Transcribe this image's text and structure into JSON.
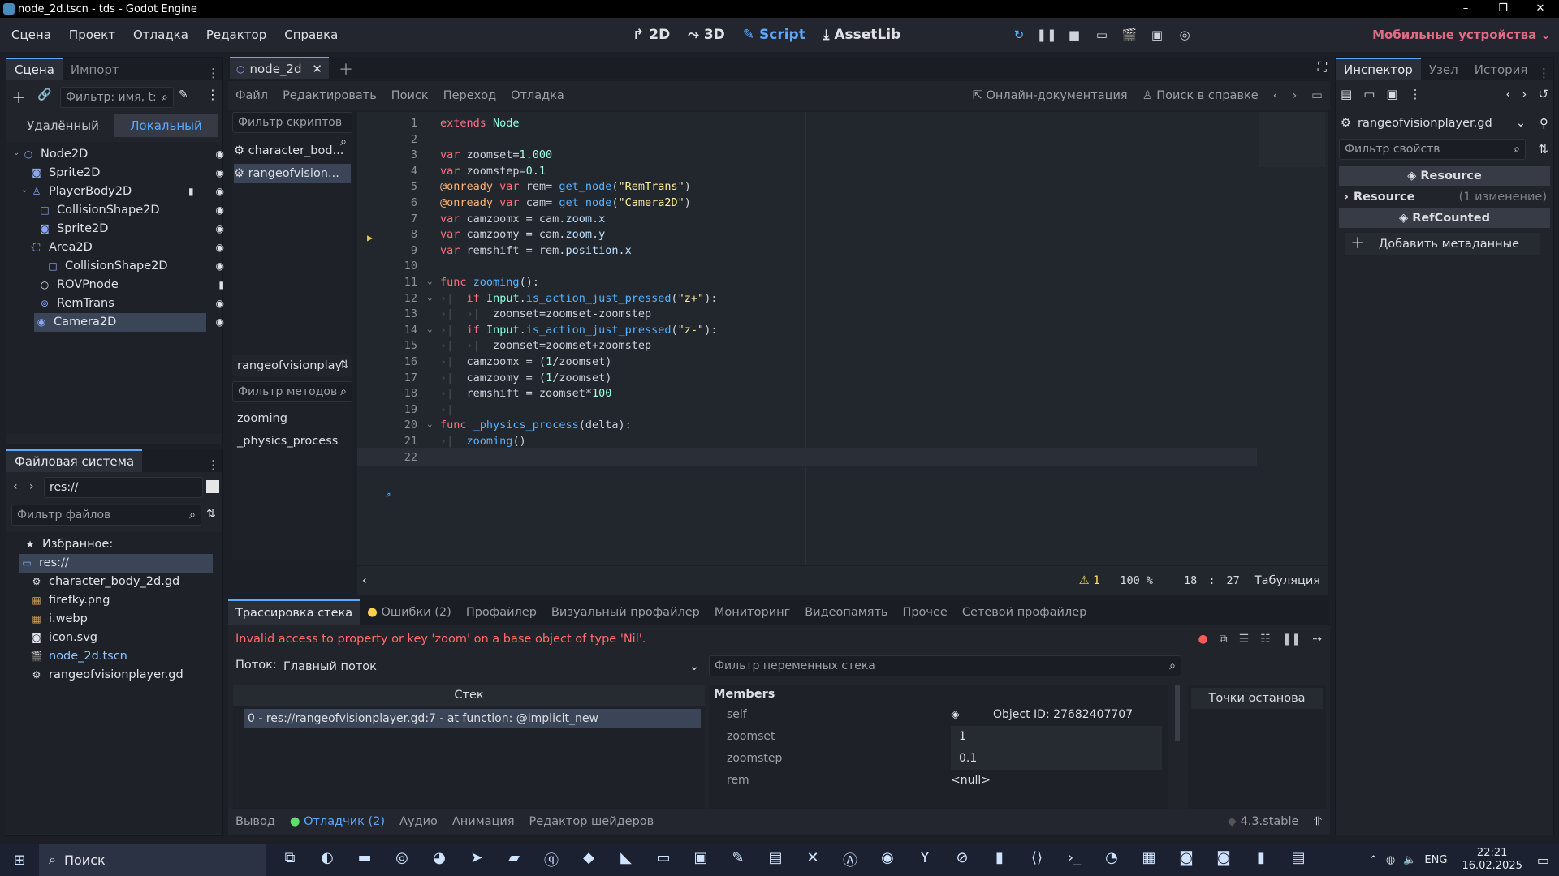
{
  "window": {
    "title": "node_2d.tscn - tds - Godot Engine",
    "minimize": "–",
    "maximize": "❐",
    "close": "✕"
  },
  "menu": [
    "Сцена",
    "Проект",
    "Отладка",
    "Редактор",
    "Справка"
  ],
  "modes": [
    {
      "label": "2D",
      "icon": "2d-icon",
      "glyph": "↱"
    },
    {
      "label": "3D",
      "icon": "3d-icon",
      "glyph": "⤳"
    },
    {
      "label": "Script",
      "icon": "script-icon",
      "glyph": "✎"
    },
    {
      "label": "AssetLib",
      "icon": "assetlib-icon",
      "glyph": "⤓"
    }
  ],
  "run_controls": [
    {
      "icon": "restart-icon",
      "glyph": "↻"
    },
    {
      "icon": "pause-icon",
      "glyph": "❚❚"
    },
    {
      "icon": "stop-icon",
      "glyph": "■"
    },
    {
      "icon": "remote-debug-icon",
      "glyph": "▭"
    },
    {
      "icon": "play-scene-icon",
      "glyph": "🎬"
    },
    {
      "icon": "play-custom-icon",
      "glyph": "▣"
    },
    {
      "icon": "movie-maker-icon",
      "glyph": "◎"
    }
  ],
  "renderer": "Мобильные устройства ⌄",
  "scene_panel": {
    "tabs": [
      "Сцена",
      "Импорт"
    ],
    "filter_placeholder": "Фильтр: имя, t:",
    "mode_tabs": [
      "Удалённый",
      "Локальный"
    ],
    "nodes": [
      {
        "name": "Node2D",
        "icon": "node2d-icon",
        "glyph": "○",
        "color": "#8da5f3"
      },
      {
        "name": "Sprite2D",
        "icon": "sprite2d-icon",
        "glyph": "◙",
        "color": "#8da5f3"
      },
      {
        "name": "PlayerBody2D",
        "icon": "characterbody2d-icon",
        "glyph": "♙",
        "color": "#8da5f3"
      },
      {
        "name": "CollisionShape2D",
        "icon": "collisionshape2d-icon",
        "glyph": "□",
        "color": "#8da5f3"
      },
      {
        "name": "Sprite2D",
        "icon": "sprite2d-icon",
        "glyph": "◙",
        "color": "#8da5f3"
      },
      {
        "name": "Area2D",
        "icon": "area2d-icon",
        "glyph": "⛶",
        "color": "#8da5f3"
      },
      {
        "name": "CollisionShape2D",
        "icon": "collisionshape2d-icon",
        "glyph": "□",
        "color": "#8da5f3"
      },
      {
        "name": "ROVPnode",
        "icon": "node-icon",
        "glyph": "○",
        "color": "#e0e0e0"
      },
      {
        "name": "RemTrans",
        "icon": "remotetransform2d-icon",
        "glyph": "⊚",
        "color": "#8da5f3"
      },
      {
        "name": "Camera2D",
        "icon": "camera2d-icon",
        "glyph": "◉",
        "color": "#8da5f3"
      }
    ]
  },
  "filesystem": {
    "title": "Файловая система",
    "path": "res://",
    "filter_placeholder": "Фильтр файлов",
    "favorites": "Избранное:",
    "items": [
      {
        "name": "res://",
        "icon": "folder-icon",
        "glyph": "▭"
      },
      {
        "name": "character_body_2d.gd",
        "icon": "gdscript-icon",
        "glyph": "⚙"
      },
      {
        "name": "firefky.png",
        "icon": "image-icon",
        "glyph": "▦"
      },
      {
        "name": "i.webp",
        "icon": "image-icon",
        "glyph": "▦"
      },
      {
        "name": "icon.svg",
        "icon": "svg-icon",
        "glyph": "◙"
      },
      {
        "name": "node_2d.tscn",
        "icon": "scene-icon",
        "glyph": "🎬"
      },
      {
        "name": "rangeofvisionplayer.gd",
        "icon": "gdscript-icon",
        "glyph": "⚙"
      }
    ]
  },
  "editor_tab": "node_2d",
  "script_menu": [
    "Файл",
    "Редактировать",
    "Поиск",
    "Переход",
    "Отладка"
  ],
  "online_docs": "Онлайн-документация",
  "search_help": "Поиск в справке",
  "scripts_filter": "Фильтр скриптов",
  "scripts": [
    "character_bod...",
    "rangeofvision..."
  ],
  "current_script_name": "rangeofvisionplay",
  "methods_filter": "Фильтр методов",
  "methods": [
    "zooming",
    "_physics_process"
  ],
  "code_lines": [
    {
      "n": "1",
      "html": "<span class='kw'>extends</span> <span class='cls'>Node</span>"
    },
    {
      "n": "2",
      "html": ""
    },
    {
      "n": "3",
      "html": "<span class='kw'>var</span> zoomset=<span class='num'>1.000</span>"
    },
    {
      "n": "4",
      "html": "<span class='kw'>var</span> zoomstep=<span class='num'>0.1</span>"
    },
    {
      "n": "5",
      "html": "<span class='ann'>@onready</span> <span class='kw'>var</span> rem= <span class='fn'>get_node</span>(<span class='str'>\"RemTrans\"</span>)"
    },
    {
      "n": "6",
      "html": "<span class='ann'>@onready</span> <span class='kw'>var</span> cam= <span class='fn'>get_node</span>(<span class='str'>\"Camera2D\"</span>)"
    },
    {
      "n": "7",
      "html": "<span class='kw'>var</span> camzoomx = cam.<span class='mem'>zoom</span>.<span class='mem'>x</span>"
    },
    {
      "n": "8",
      "html": "<span class='kw'>var</span> camzoomy = cam.<span class='mem'>zoom</span>.<span class='mem'>y</span>"
    },
    {
      "n": "9",
      "html": "<span class='kw'>var</span> remshift = rem.<span class='mem'>position</span>.<span class='mem'>x</span>"
    },
    {
      "n": "10",
      "html": ""
    },
    {
      "n": "11",
      "html": "<span class='kw'>func</span> <span class='fn'>zooming</span>():"
    },
    {
      "n": "12",
      "html": "<span class='tabmark'>›|</span>  <span class='kw'>if</span> <span class='cls'>Input</span>.<span class='fn'>is_action_just_pressed</span>(<span class='str'>\"z+\"</span>):"
    },
    {
      "n": "13",
      "html": "<span class='tabmark'>›|</span>  <span class='tabmark'>›|</span>  zoomset=zoomset-zoomstep"
    },
    {
      "n": "14",
      "html": "<span class='tabmark'>›|</span>  <span class='kw'>if</span> <span class='cls'>Input</span>.<span class='fn'>is_action_just_pressed</span>(<span class='str'>\"z-\"</span>):"
    },
    {
      "n": "15",
      "html": "<span class='tabmark'>›|</span>  <span class='tabmark'>›|</span>  zoomset=zoomset+zoomstep"
    },
    {
      "n": "16",
      "html": "<span class='tabmark'>›|</span>  camzoomx = (<span class='num'>1</span>/zoomset)"
    },
    {
      "n": "17",
      "html": "<span class='tabmark'>›|</span>  camzoomy = (<span class='num'>1</span>/zoomset)"
    },
    {
      "n": "18",
      "html": "<span class='tabmark'>›|</span>  remshift = zoomset*<span class='num'>100</span>"
    },
    {
      "n": "19",
      "html": "<span class='tabmark'>›|</span>"
    },
    {
      "n": "20",
      "html": "<span class='kw'>func</span> <span class='fn'>_physics_process</span>(delta):"
    },
    {
      "n": "21",
      "html": "<span class='tabmark'>›|</span>  <span class='fn'>zooming</span>()"
    },
    {
      "n": "22",
      "html": ""
    }
  ],
  "status": {
    "warnings": "1",
    "zoom": "100 %",
    "line": "18",
    "sep": ":",
    "col": "27",
    "indent": "Табуляция"
  },
  "bottom_tabs": [
    "Трассировка стека",
    "Ошибки (2)",
    "Профайлер",
    "Визуальный профайлер",
    "Мониторинг",
    "Видеопамять",
    "Прочее",
    "Сетевой профайлер"
  ],
  "error_text": "Invalid access to property or key 'zoom' on a base object of type 'Nil'.",
  "thread_label": "Поток:",
  "thread_value": "Главный поток",
  "stack_header": "Стек",
  "stack_frame": "0 - res://rangeofvisionplayer.gd:7 - at function: @implicit_new",
  "var_filter": "Фильтр переменных стека",
  "members_title": "Members",
  "members": [
    {
      "name": "self",
      "value": "Object ID: 27682407707"
    },
    {
      "name": "zoomset",
      "value": "1"
    },
    {
      "name": "zoomstep",
      "value": "0.1"
    },
    {
      "name": "rem",
      "value": "<null>"
    }
  ],
  "breakpoints": "Точки останова",
  "footer_tabs": [
    "Вывод",
    "Отладчик (2)",
    "Аудио",
    "Анимация",
    "Редактор шейдеров"
  ],
  "version": "4.3.stable",
  "inspector": {
    "tabs": [
      "Инспектор",
      "Узел",
      "История"
    ],
    "resource_name": "rangeofvisionplayer.gd",
    "filter_placeholder": "Фильтр свойств",
    "section1": "Resource",
    "resource_row": "Resource",
    "changes": "(1 изменение)",
    "section2": "RefCounted",
    "add_meta": "Добавить метаданные"
  },
  "taskbar": {
    "search": "Поиск",
    "time": "22:21",
    "date": "16.02.2025",
    "lang": "ENG",
    "apps": [
      {
        "icon": "task-view-icon",
        "glyph": "⧉"
      },
      {
        "icon": "edge-icon",
        "glyph": "◐"
      },
      {
        "icon": "explorer-icon",
        "glyph": "▬"
      },
      {
        "icon": "steam-icon",
        "glyph": "◎"
      },
      {
        "icon": "discord-icon",
        "glyph": "◕"
      },
      {
        "icon": "telegram-icon",
        "glyph": "➤"
      },
      {
        "icon": "app-icon",
        "glyph": "▰"
      },
      {
        "icon": "qbittorrent-icon",
        "glyph": "ⓠ"
      },
      {
        "icon": "app-icon",
        "glyph": "◆"
      },
      {
        "icon": "visual-studio-icon",
        "glyph": "◣"
      },
      {
        "icon": "terminal-icon",
        "glyph": "▭"
      },
      {
        "icon": "save-icon",
        "glyph": "▣"
      },
      {
        "icon": "paint-icon",
        "glyph": "✎"
      },
      {
        "icon": "app-icon",
        "glyph": "▤"
      },
      {
        "icon": "x-icon",
        "glyph": "✕"
      },
      {
        "icon": "appstore-icon",
        "glyph": "Ⓐ"
      },
      {
        "icon": "obs-icon",
        "glyph": "◉"
      },
      {
        "icon": "yandex-icon",
        "glyph": "Y"
      },
      {
        "icon": "app-icon",
        "glyph": "⊘"
      },
      {
        "icon": "app-icon",
        "glyph": "▮"
      },
      {
        "icon": "vscode-icon",
        "glyph": "⟨⟩"
      },
      {
        "icon": "powershell-icon",
        "glyph": "›_"
      },
      {
        "icon": "firefox-icon",
        "glyph": "◔"
      },
      {
        "icon": "app-icon",
        "glyph": "▦"
      },
      {
        "icon": "godot-icon",
        "glyph": "◙"
      },
      {
        "icon": "godot-icon",
        "glyph": "◙"
      },
      {
        "icon": "app-icon",
        "glyph": "▮"
      },
      {
        "icon": "app-icon",
        "glyph": "▤"
      }
    ]
  }
}
